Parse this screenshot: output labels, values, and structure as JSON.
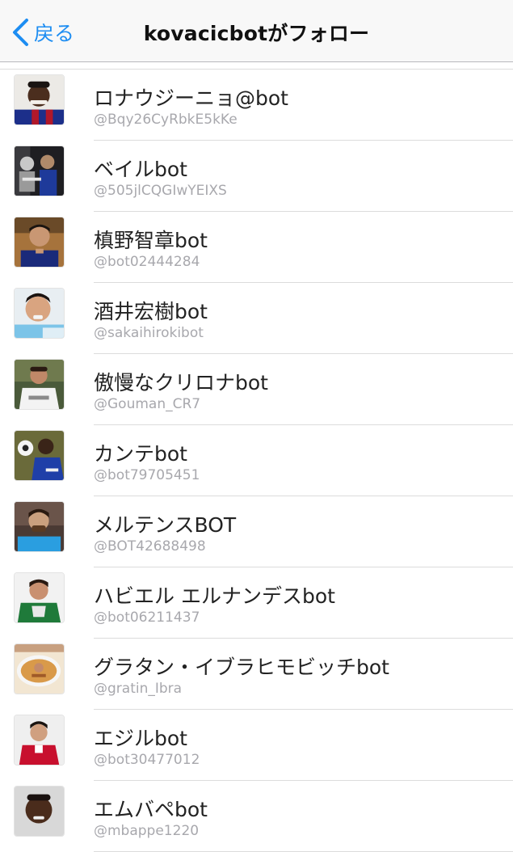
{
  "nav": {
    "back_label": "戻る",
    "title": "kovacicbotがフォロー"
  },
  "accent_color": "#1d8df2",
  "users": [
    {
      "name": "ロナウジーニョ@bot",
      "handle": "@Bqy26CyRbkE5kKe",
      "avatar_icon": "player-blue-red-kit-avatar"
    },
    {
      "name": "ベイルbot",
      "handle": "@505jlCQGIwYEIXS",
      "avatar_icon": "player-dark-photo-avatar"
    },
    {
      "name": "槙野智章bot",
      "handle": "@bot02444284",
      "avatar_icon": "player-blue-kit-avatar"
    },
    {
      "name": "酒井宏樹bot",
      "handle": "@sakaihirokibot",
      "avatar_icon": "player-sky-blue-kit-avatar"
    },
    {
      "name": "傲慢なクリロナbot",
      "handle": "@Gouman_CR7",
      "avatar_icon": "player-white-kit-avatar"
    },
    {
      "name": "カンテbot",
      "handle": "@bot79705451",
      "avatar_icon": "player-with-ball-avatar"
    },
    {
      "name": "メルテンスBOT",
      "handle": "@BOT42688498",
      "avatar_icon": "player-light-blue-kit-avatar"
    },
    {
      "name": "ハビエル エルナンデスbot",
      "handle": "@bot06211437",
      "avatar_icon": "player-green-kit-avatar"
    },
    {
      "name": "グラタン・イブラヒモビッチbot",
      "handle": "@gratin_Ibra",
      "avatar_icon": "gratin-dish-avatar"
    },
    {
      "name": "エジルbot",
      "handle": "@bot30477012",
      "avatar_icon": "player-red-kit-avatar"
    },
    {
      "name": "エムバペbot",
      "handle": "@mbappe1220",
      "avatar_icon": "player-portrait-avatar"
    }
  ]
}
